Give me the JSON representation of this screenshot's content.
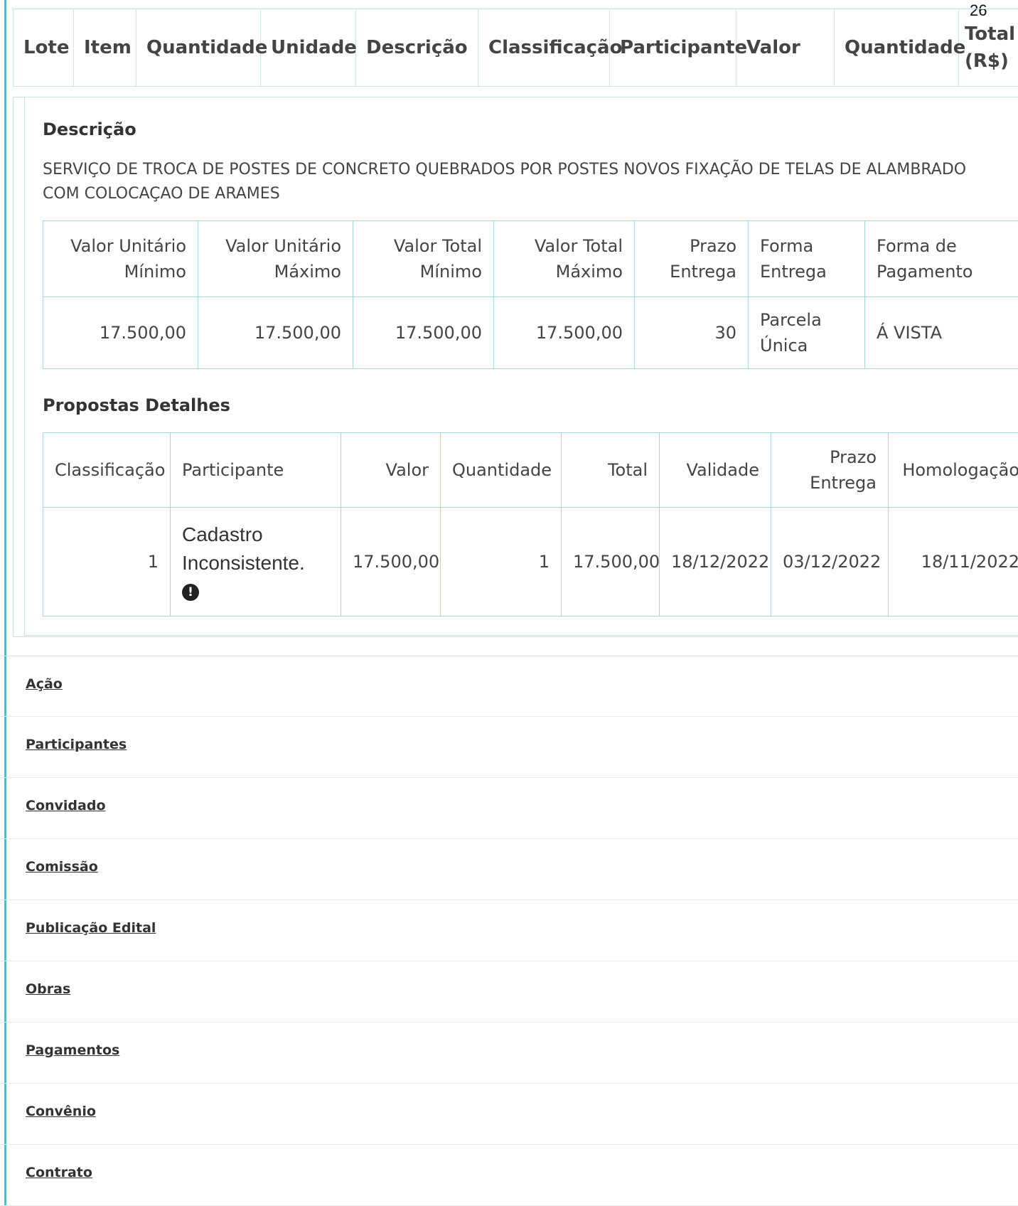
{
  "page_number": "26",
  "header": {
    "columns": [
      "Lote",
      "Item",
      "Quantidade",
      "Unidade",
      "Descrição",
      "Classificação",
      "Participante",
      "Valor",
      "Quantidade",
      "Total (R$)"
    ]
  },
  "detail": {
    "description_title": "Descrição",
    "description_text": "SERVIÇO DE TROCA DE POSTES DE CONCRETO QUEBRADOS POR POSTES NOVOS FIXAÇÃO DE TELAS DE ALAMBRADO COM COLOCAÇAO DE ARAMES",
    "values_table": {
      "headers": [
        "Valor Unitário Mínimo",
        "Valor Unitário Máximo",
        "Valor Total Mínimo",
        "Valor Total Máximo",
        "Prazo Entrega",
        "Forma Entrega",
        "Forma de Pagamento"
      ],
      "row": [
        "17.500,00",
        "17.500,00",
        "17.500,00",
        "17.500,00",
        "30",
        "Parcela Única",
        "Á VISTA"
      ]
    },
    "proposals_title": "Propostas Detalhes",
    "proposals_table": {
      "headers": [
        "Classificação",
        "Participante",
        "Valor",
        "Quantidade",
        "Total",
        "Validade",
        "Prazo Entrega",
        "Homologação"
      ],
      "row": {
        "classificacao": "1",
        "participante": "Cadastro Inconsistente.",
        "valor": "17.500,00",
        "quantidade": "1",
        "total": "17.500,00",
        "validade": "18/12/2022",
        "prazo_entrega": "03/12/2022",
        "homologacao": "18/11/2022"
      }
    }
  },
  "nav": {
    "links": [
      "Ação",
      "Participantes",
      "Convidado",
      "Comissão",
      "Publicação Edital",
      "Obras",
      "Pagamentos",
      "Convênio",
      "Contrato"
    ]
  },
  "icons": {
    "participant_status": "exclamation-circle-icon"
  },
  "colors": {
    "accent": "#5fb3c2",
    "table_border": "#a9d6df"
  }
}
